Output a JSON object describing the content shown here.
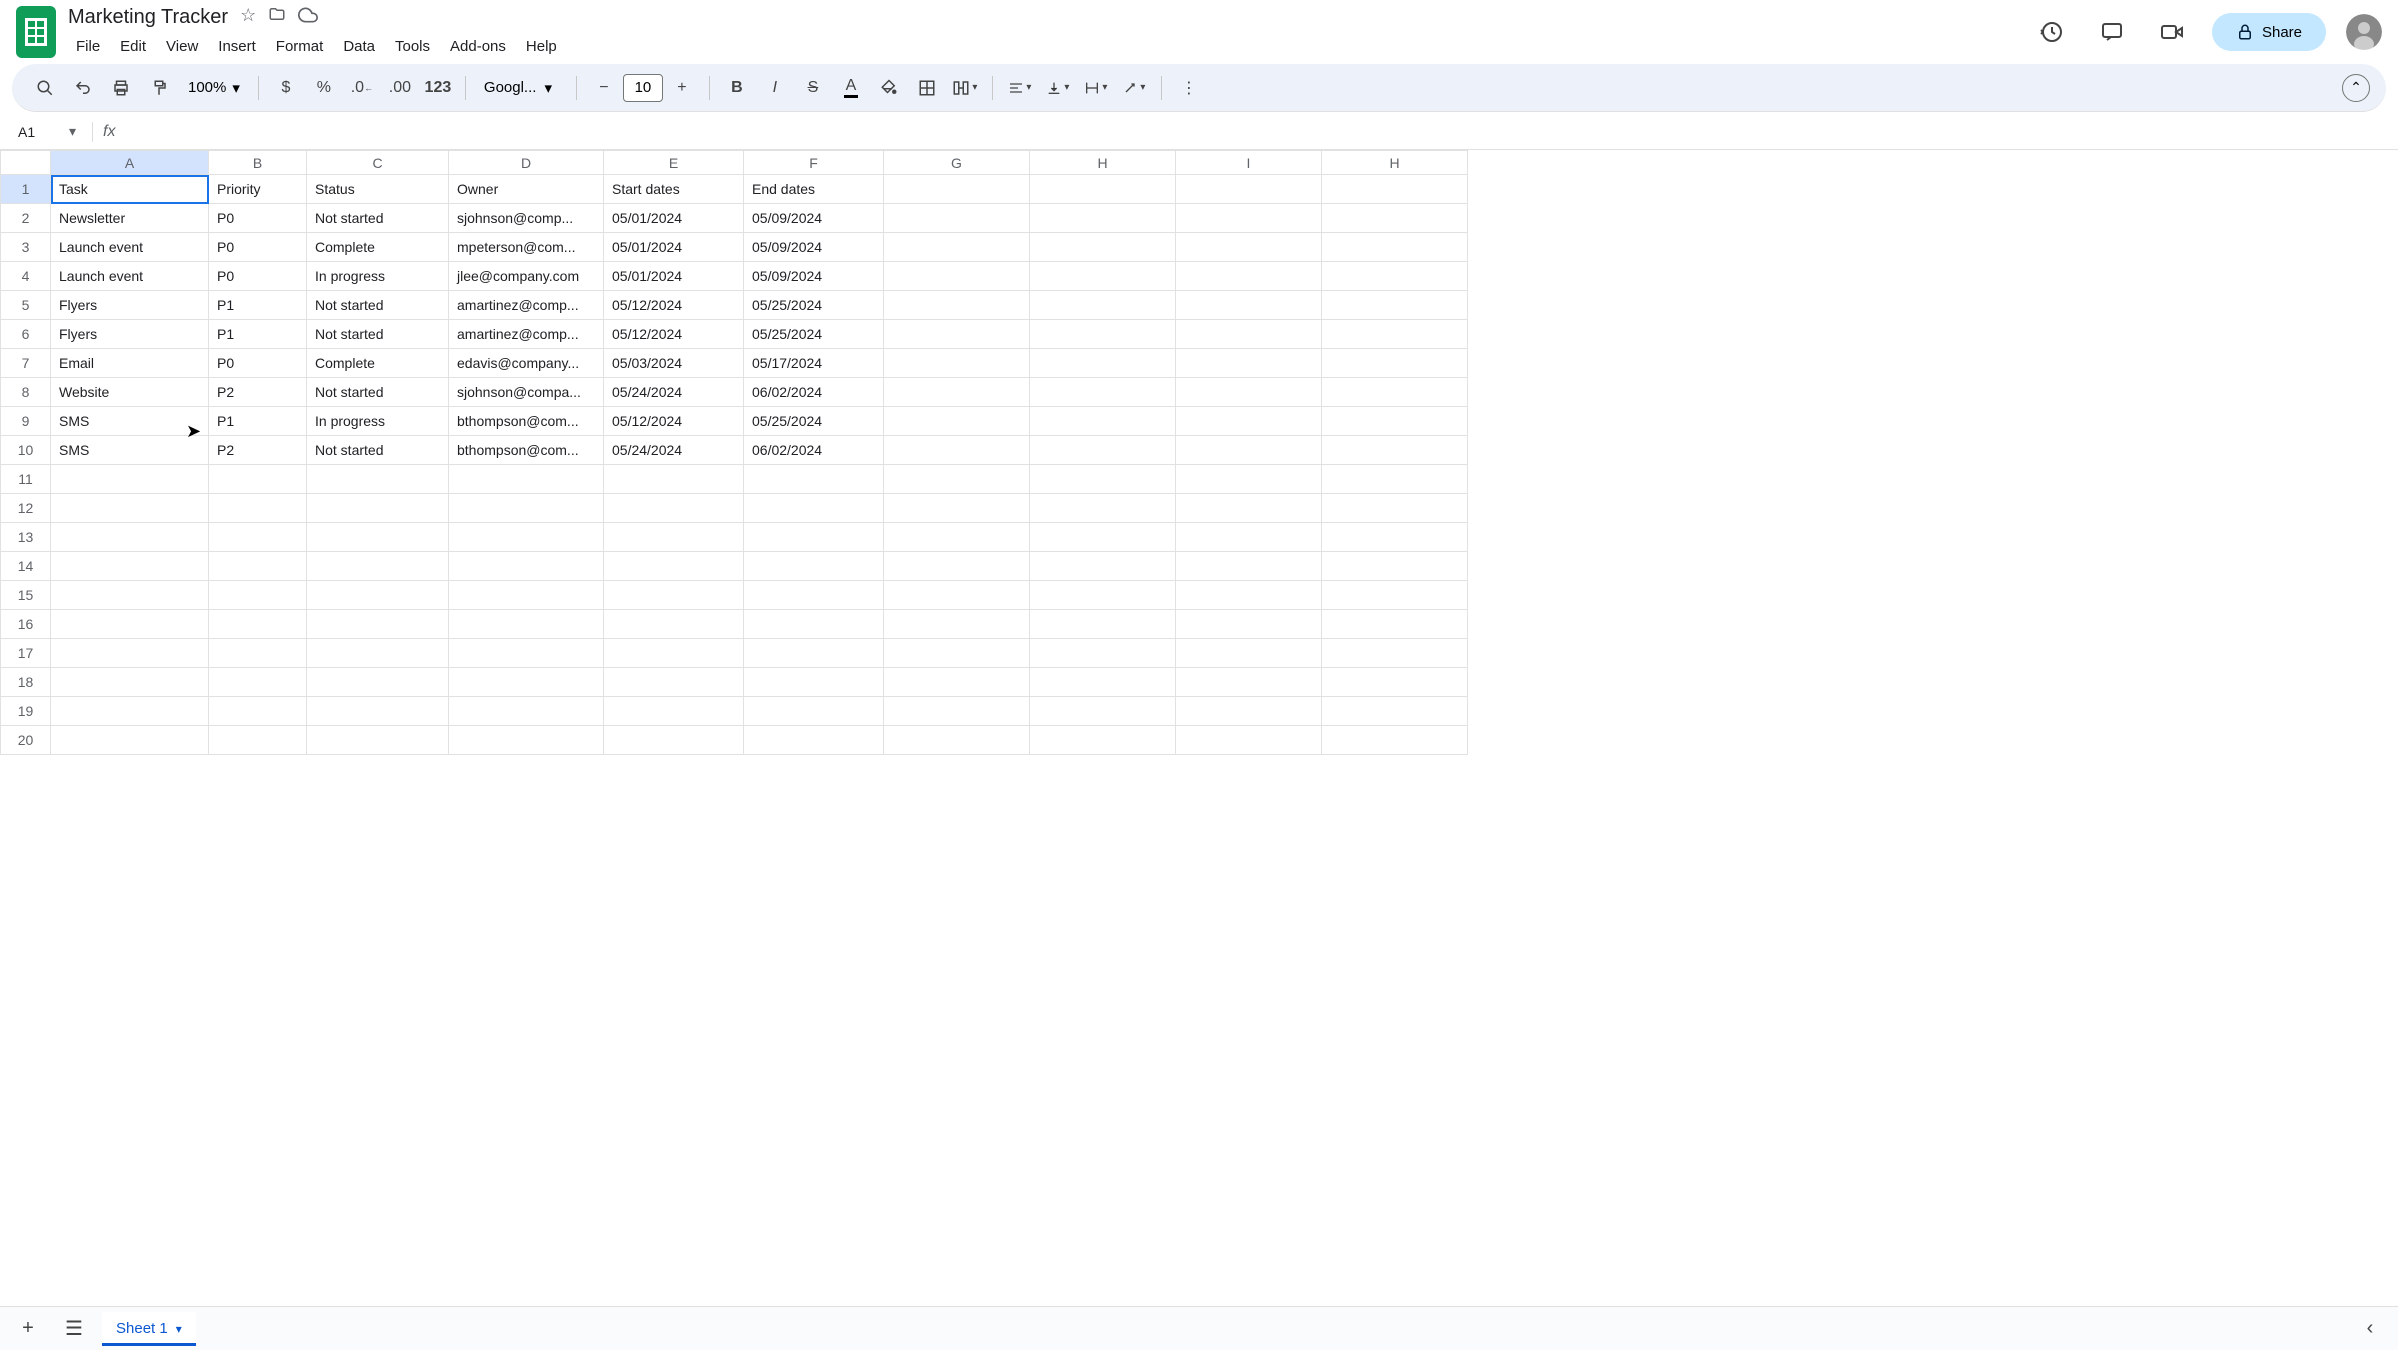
{
  "doc_title": "Marketing Tracker",
  "menus": [
    "File",
    "Edit",
    "View",
    "Insert",
    "Format",
    "Data",
    "Tools",
    "Add-ons",
    "Help"
  ],
  "share_label": "Share",
  "zoom": "100%",
  "font_name": "Googl...",
  "font_size": "10",
  "name_box": "A1",
  "columns": [
    "A",
    "B",
    "C",
    "D",
    "E",
    "F",
    "G",
    "H",
    "I",
    "H"
  ],
  "col_widths": [
    "col-A",
    "col-B",
    "col-C",
    "col-D",
    "col-E",
    "col-F",
    "col-G",
    "col-H",
    "col-I",
    "col-HH"
  ],
  "headers": [
    "Task",
    "Priority",
    "Status",
    "Owner",
    "Start dates",
    "End dates"
  ],
  "rows": [
    {
      "task": "Newsletter",
      "priority": "P0",
      "status": "Not started",
      "owner": "sjohnson@comp...",
      "start": "05/01/2024",
      "end": "05/09/2024"
    },
    {
      "task": "Launch event",
      "priority": "P0",
      "status": "Complete",
      "owner": "mpeterson@com...",
      "start": "05/01/2024",
      "end": "05/09/2024"
    },
    {
      "task": "Launch event",
      "priority": "P0",
      "status": "In progress",
      "owner": "jlee@company.com",
      "start": "05/01/2024",
      "end": "05/09/2024"
    },
    {
      "task": "Flyers",
      "priority": "P1",
      "status": "Not started",
      "owner": "amartinez@comp...",
      "start": "05/12/2024",
      "end": "05/25/2024"
    },
    {
      "task": "Flyers",
      "priority": "P1",
      "status": "Not started",
      "owner": "amartinez@comp...",
      "start": "05/12/2024",
      "end": "05/25/2024"
    },
    {
      "task": "Email",
      "priority": "P0",
      "status": "Complete",
      "owner": "edavis@company...",
      "start": "05/03/2024",
      "end": "05/17/2024"
    },
    {
      "task": "Website",
      "priority": "P2",
      "status": "Not started",
      "owner": "sjohnson@compa...",
      "start": "05/24/2024",
      "end": "06/02/2024"
    },
    {
      "task": "SMS",
      "priority": "P1",
      "status": "In progress",
      "owner": "bthompson@com...",
      "start": "05/12/2024",
      "end": "05/25/2024"
    },
    {
      "task": "SMS",
      "priority": "P2",
      "status": "Not started",
      "owner": "bthompson@com...",
      "start": "05/24/2024",
      "end": "06/02/2024"
    }
  ],
  "empty_rows": [
    11,
    12,
    13,
    14,
    15,
    16,
    17,
    18,
    19,
    20
  ],
  "sheet_tab": "Sheet 1"
}
